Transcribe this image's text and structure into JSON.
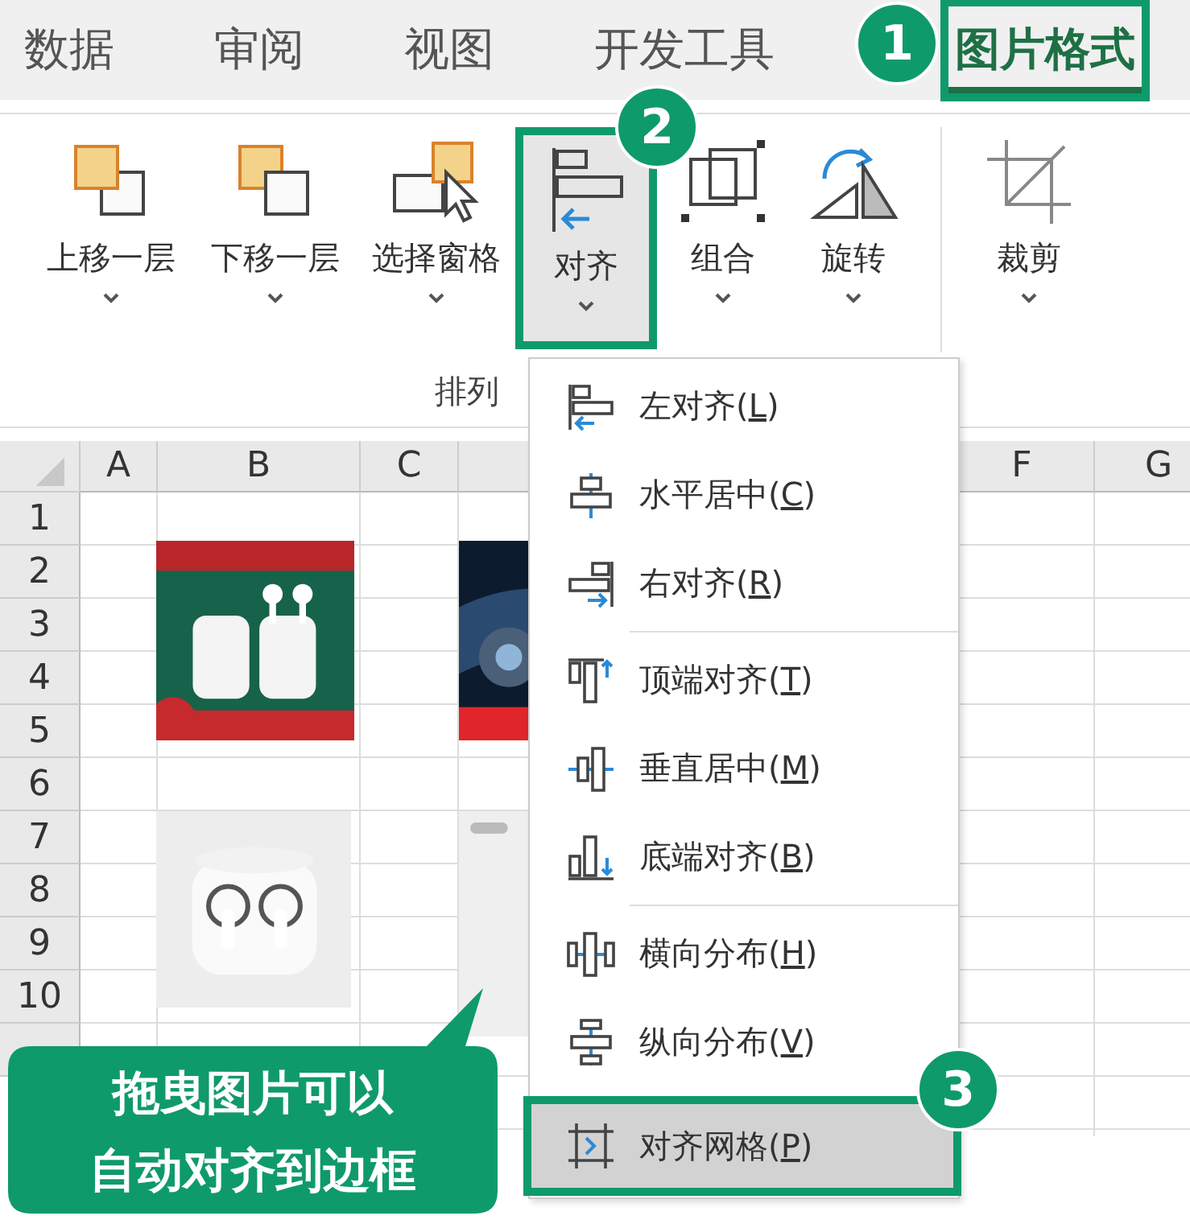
{
  "tabs": [
    {
      "label": "数据",
      "selected": false,
      "annotated": false
    },
    {
      "label": "审阅",
      "selected": false,
      "annotated": false
    },
    {
      "label": "视图",
      "selected": false,
      "annotated": false
    },
    {
      "label": "开发工具",
      "selected": false,
      "annotated": false
    },
    {
      "label": "图片格式",
      "selected": true,
      "annotated": true,
      "badge": "1"
    }
  ],
  "ribbon": {
    "buttons": [
      {
        "kind": "bring-forward",
        "label": "上移一层",
        "pressed": false,
        "annotated": false
      },
      {
        "kind": "send-backward",
        "label": "下移一层",
        "pressed": false,
        "annotated": false
      },
      {
        "kind": "selection-pane",
        "label": "选择窗格",
        "pressed": false,
        "annotated": false
      },
      {
        "kind": "align",
        "label": "对齐",
        "pressed": true,
        "annotated": true,
        "badge": "2"
      },
      {
        "kind": "group",
        "label": "组合",
        "pressed": false,
        "annotated": false
      },
      {
        "kind": "rotate",
        "label": "旋转",
        "pressed": false,
        "annotated": false
      },
      {
        "kind": "crop",
        "label": "裁剪",
        "pressed": false,
        "annotated": false
      }
    ],
    "group_label": "排列"
  },
  "sheet": {
    "columns": [
      {
        "label": "A"
      },
      {
        "label": "B"
      },
      {
        "label": "C"
      },
      {},
      {
        "label": "F"
      },
      {
        "label": "G"
      }
    ],
    "rows": [
      "1",
      "2",
      "3",
      "4",
      "5",
      "6",
      "7",
      "8",
      "9",
      "10"
    ]
  },
  "align_menu": {
    "items": [
      {
        "kind": "align-left",
        "text_before": "左对齐(",
        "key": "L",
        "text_after": ")",
        "selected": false,
        "annotated": false
      },
      {
        "kind": "align-center",
        "text_before": "水平居中(",
        "key": "C",
        "text_after": ")",
        "selected": false,
        "annotated": false
      },
      {
        "kind": "align-right",
        "text_before": "右对齐(",
        "key": "R",
        "text_after": ")",
        "selected": false,
        "annotated": false,
        "separator_after": true
      },
      {
        "kind": "align-top",
        "text_before": "顶端对齐(",
        "key": "T",
        "text_after": ")",
        "selected": false,
        "annotated": false
      },
      {
        "kind": "align-middle",
        "text_before": "垂直居中(",
        "key": "M",
        "text_after": ")",
        "selected": false,
        "annotated": false
      },
      {
        "kind": "align-bottom",
        "text_before": "底端对齐(",
        "key": "B",
        "text_after": ")",
        "selected": false,
        "annotated": false,
        "separator_after": true
      },
      {
        "kind": "distribute-horizontal",
        "text_before": "横向分布(",
        "key": "H",
        "text_after": ")",
        "selected": false,
        "annotated": false
      },
      {
        "kind": "distribute-vertical",
        "text_before": "纵向分布(",
        "key": "V",
        "text_after": ")",
        "selected": false,
        "annotated": false
      },
      {
        "kind": "snap-to-grid",
        "text_before": "对齐网格(",
        "key": "P",
        "text_after": ")",
        "selected": true,
        "annotated": true,
        "badge": "3"
      }
    ]
  },
  "callout": {
    "lines": [
      "拖曳图片可以",
      "自动对齐到边框"
    ]
  }
}
